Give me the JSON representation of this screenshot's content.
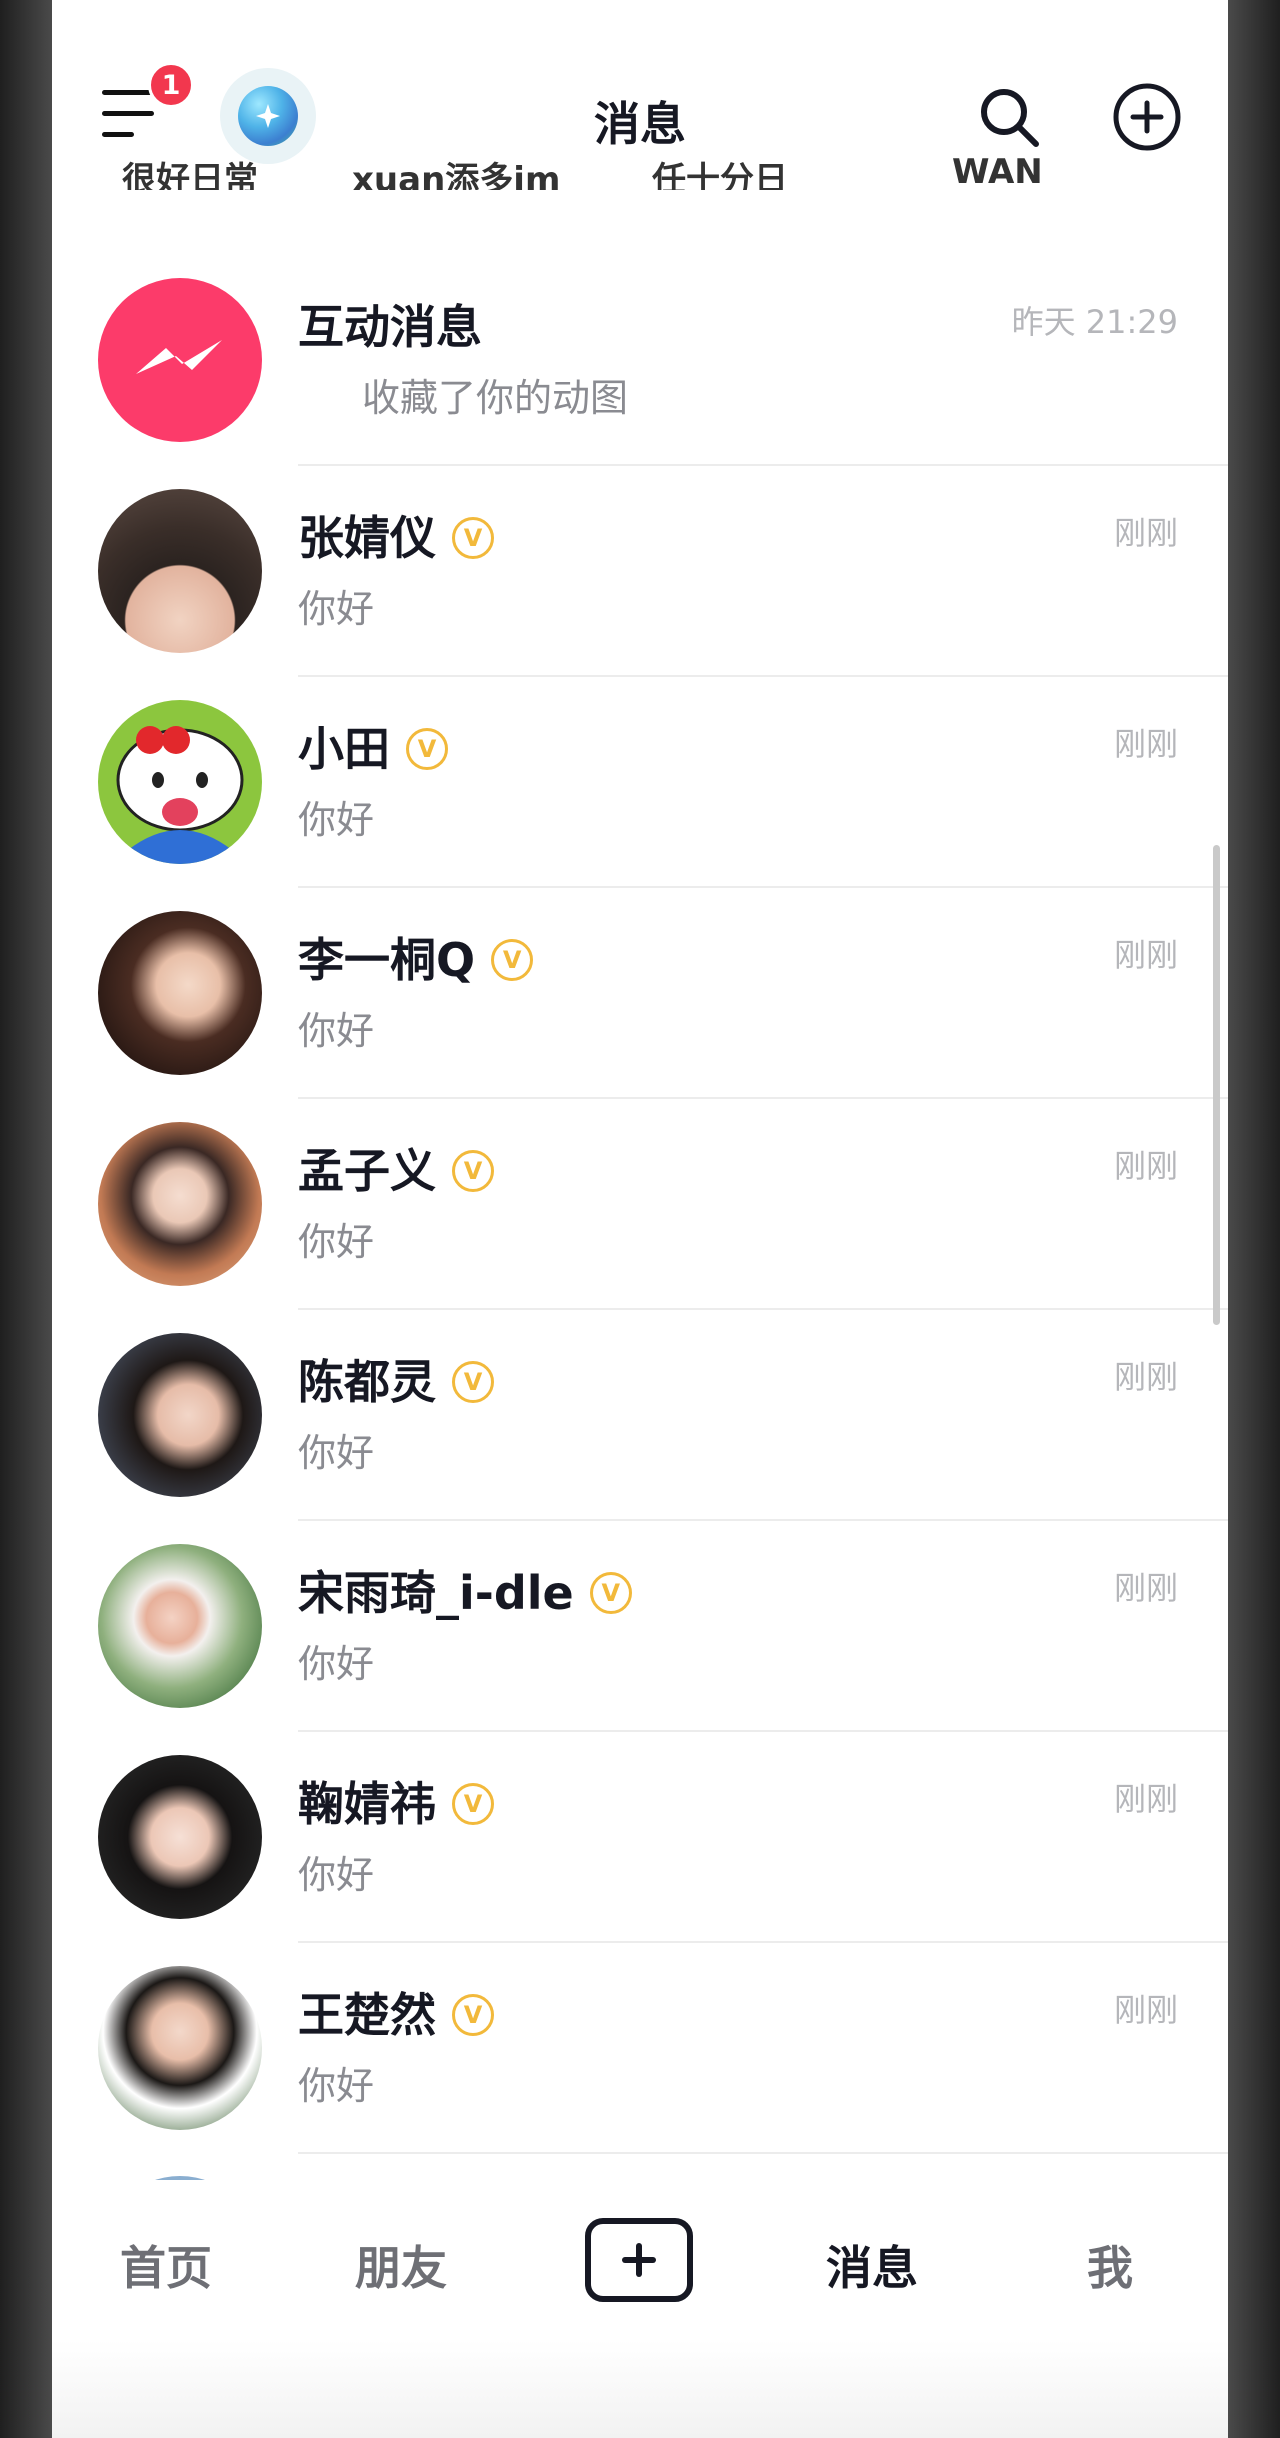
{
  "header": {
    "title": "消息",
    "menu_badge": "1",
    "story_names": [
      "很好日常",
      "xuan添多im",
      "任十分日",
      "WAN"
    ]
  },
  "interaction": {
    "title": "互动消息",
    "time": "昨天 21:29",
    "message": "收藏了你的动图",
    "icon": "messenger-bolt-icon",
    "accent": "#fc3b6a"
  },
  "chats": [
    {
      "name": "张婧仪",
      "message": "你好",
      "time": "刚刚",
      "verified": true
    },
    {
      "name": "小田",
      "message": "你好",
      "time": "刚刚",
      "verified": true
    },
    {
      "name": "李一桐Q",
      "message": "你好",
      "time": "刚刚",
      "verified": true
    },
    {
      "name": "孟子义",
      "message": "你好",
      "time": "刚刚",
      "verified": true
    },
    {
      "name": "陈都灵",
      "message": "你好",
      "time": "刚刚",
      "verified": true
    },
    {
      "name": "宋雨琦_i-dle",
      "message": "你好",
      "time": "刚刚",
      "verified": true
    },
    {
      "name": "鞠婧祎",
      "message": "你好",
      "time": "刚刚",
      "verified": true
    },
    {
      "name": "王楚然",
      "message": "你好",
      "time": "刚刚",
      "verified": true
    }
  ],
  "verified_mark": "V",
  "nav": {
    "home": "首页",
    "friends": "朋友",
    "messages": "消息",
    "me": "我"
  },
  "colors": {
    "badge_red": "#f2374e",
    "verified_gold": "#f2b93b",
    "text_primary": "#161823",
    "text_secondary": "#8a8b91"
  }
}
